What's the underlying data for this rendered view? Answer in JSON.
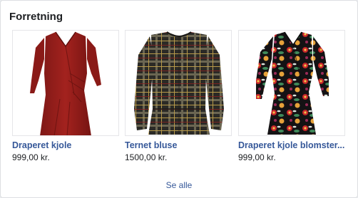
{
  "section": {
    "title": "Forretning"
  },
  "products": [
    {
      "name": "Draperet kjole",
      "price": "999,00 kr.",
      "image": "red-wrap-dress-photo"
    },
    {
      "name": "Ternet bluse",
      "price": "1500,00 kr.",
      "image": "plaid-blouse-photo"
    },
    {
      "name": "Draperet kjole blomster...",
      "price": "999,00 kr.",
      "image": "floral-wrap-dress-photo"
    }
  ],
  "footer": {
    "see_all_label": "Se alle"
  },
  "colors": {
    "link": "#365899",
    "text": "#1c1e21",
    "card_border": "#dddfe2",
    "page_bg": "#e9ebee"
  }
}
